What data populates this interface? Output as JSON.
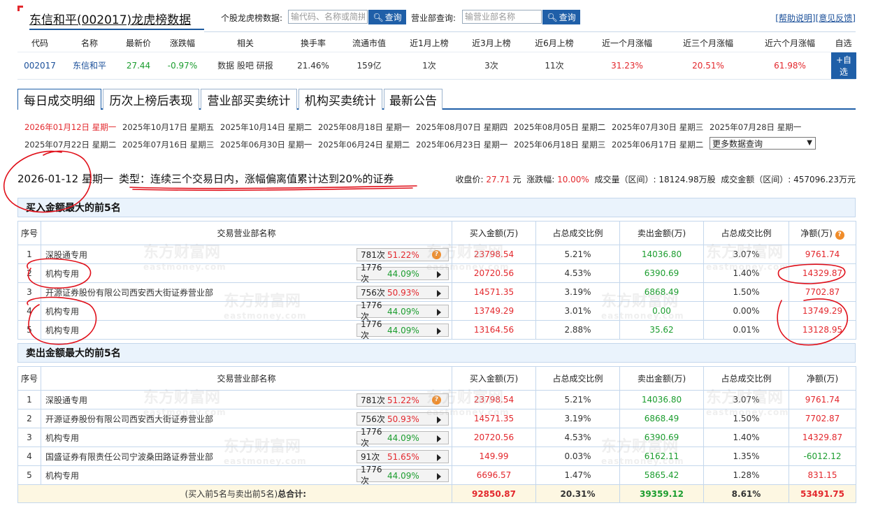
{
  "header": {
    "title": "东信和平(002017)龙虎榜数据",
    "stock_search_label": "个股龙虎榜数据:",
    "stock_search_placeholder": "输代码、名称或简拼",
    "query_label": "查询",
    "dept_search_label": "营业部查询:",
    "dept_search_placeholder": "输营业部名称",
    "help_link": "[帮助说明]",
    "feedback_link": "[意见反馈]"
  },
  "summary": {
    "headers": [
      "代码",
      "名称",
      "最新价",
      "涨跌幅",
      "相关",
      "换手率",
      "流通市值",
      "近1月上榜",
      "近3月上榜",
      "近6月上榜",
      "近一个月涨幅",
      "近三个月涨幅",
      "近六个月涨幅",
      "自选"
    ],
    "code": "002017",
    "name": "东信和平",
    "price": "27.44",
    "change": "-0.97%",
    "related": "数据 股吧 研报",
    "turnover": "21.46%",
    "float_cap": "159亿",
    "m1": "1次",
    "m3": "3次",
    "m6": "11次",
    "r1": "31.23%",
    "r3": "20.51%",
    "r6": "61.98%",
    "add_btn": "+自选"
  },
  "tabs": [
    "每日成交明细",
    "历次上榜后表现",
    "营业部买卖统计",
    "机构买卖统计",
    "最新公告"
  ],
  "dates_row1": [
    "2026年01月12日 星期一",
    "2025年10月17日 星期五",
    "2025年10月14日 星期二",
    "2025年08月18日 星期一",
    "2025年08月07日 星期四",
    "2025年08月05日 星期二",
    "2025年07月30日 星期三",
    "2025年07月28日 星期一"
  ],
  "dates_row2": [
    "2025年07月22日 星期二",
    "2025年07月16日 星期三",
    "2025年06月30日 星期一",
    "2025年06月24日 星期二",
    "2025年06月23日 星期一",
    "2025年06月18日 星期三",
    "2025年06月17日 星期二"
  ],
  "more_query": "更多数据查询",
  "info": {
    "date": "2026-01-12 星期一",
    "type": "类型：连续三个交易日内，涨幅偏离值累计达到20%的证券",
    "close_label": "收盘价:",
    "close": "27.71",
    "close_unit": "元",
    "chg_label": "涨跌幅:",
    "chg": "10.00%",
    "vol": "成交量（区间）: 18124.98万股",
    "amt": "成交金额（区间）: 457096.23万元"
  },
  "buy_section": {
    "title": "买入金额最大的前5名",
    "headers": [
      "序号",
      "交易营业部名称",
      "买入金额(万)",
      "占总成交比例",
      "卖出金额(万)",
      "占总成交比例",
      "净额(万)"
    ],
    "rows": [
      {
        "no": "1",
        "name": "深股通专用",
        "cnt": "781次",
        "pct": "51.22%",
        "buy": "23798.54",
        "bp": "5.21%",
        "sell": "14036.80",
        "sp": "3.07%",
        "net": "9761.74"
      },
      {
        "no": "2",
        "name": "机构专用",
        "cnt": "1776次",
        "pct": "44.09%",
        "buy": "20720.56",
        "bp": "4.53%",
        "sell": "6390.69",
        "sp": "1.40%",
        "net": "14329.87"
      },
      {
        "no": "3",
        "name": "开源证券股份有限公司西安西大街证券营业部",
        "cnt": "756次",
        "pct": "50.93%",
        "buy": "14571.35",
        "bp": "3.19%",
        "sell": "6868.49",
        "sp": "1.50%",
        "net": "7702.87"
      },
      {
        "no": "4",
        "name": "机构专用",
        "cnt": "1776次",
        "pct": "44.09%",
        "buy": "13749.29",
        "bp": "3.01%",
        "sell": "0.00",
        "sp": "0.00%",
        "net": "13749.29"
      },
      {
        "no": "5",
        "name": "机构专用",
        "cnt": "1776次",
        "pct": "44.09%",
        "buy": "13164.56",
        "bp": "2.88%",
        "sell": "35.62",
        "sp": "0.01%",
        "net": "13128.95"
      }
    ]
  },
  "sell_section": {
    "title": "卖出金额最大的前5名",
    "headers": [
      "序号",
      "交易营业部名称",
      "买入金额(万)",
      "占总成交比例",
      "卖出金额(万)",
      "占总成交比例",
      "净额(万)"
    ],
    "rows": [
      {
        "no": "1",
        "name": "深股通专用",
        "cnt": "781次",
        "pct": "51.22%",
        "buy": "23798.54",
        "bp": "5.21%",
        "sell": "14036.80",
        "sp": "3.07%",
        "net": "9761.74"
      },
      {
        "no": "2",
        "name": "开源证券股份有限公司西安西大街证券营业部",
        "cnt": "756次",
        "pct": "50.93%",
        "buy": "14571.35",
        "bp": "3.19%",
        "sell": "6868.49",
        "sp": "1.50%",
        "net": "7702.87"
      },
      {
        "no": "3",
        "name": "机构专用",
        "cnt": "1776次",
        "pct": "44.09%",
        "buy": "20720.56",
        "bp": "4.53%",
        "sell": "6390.69",
        "sp": "1.40%",
        "net": "14329.87"
      },
      {
        "no": "4",
        "name": "国盛证券有限责任公司宁波桑田路证券营业部",
        "cnt": "91次",
        "pct": "51.65%",
        "buy": "149.99",
        "bp": "0.03%",
        "sell": "6162.11",
        "sp": "1.35%",
        "net": "-6012.12"
      },
      {
        "no": "5",
        "name": "机构专用",
        "cnt": "1776次",
        "pct": "44.09%",
        "buy": "6696.57",
        "bp": "1.47%",
        "sell": "5865.42",
        "sp": "1.28%",
        "net": "831.15"
      }
    ],
    "total": {
      "label_prefix": "(买入前5名与卖出前5名)",
      "label_bold": "总合计:",
      "buy": "92850.87",
      "bp": "20.31%",
      "sell": "39359.12",
      "sp": "8.61%",
      "net": "53491.75"
    }
  },
  "watermark": {
    "cn": "东方财富网",
    "en": "eastmoney.com"
  },
  "colors": {
    "accent": "#1f5fa8",
    "up": "#e3282d",
    "down": "#1c9d2f",
    "annotation": "#e0101a"
  }
}
